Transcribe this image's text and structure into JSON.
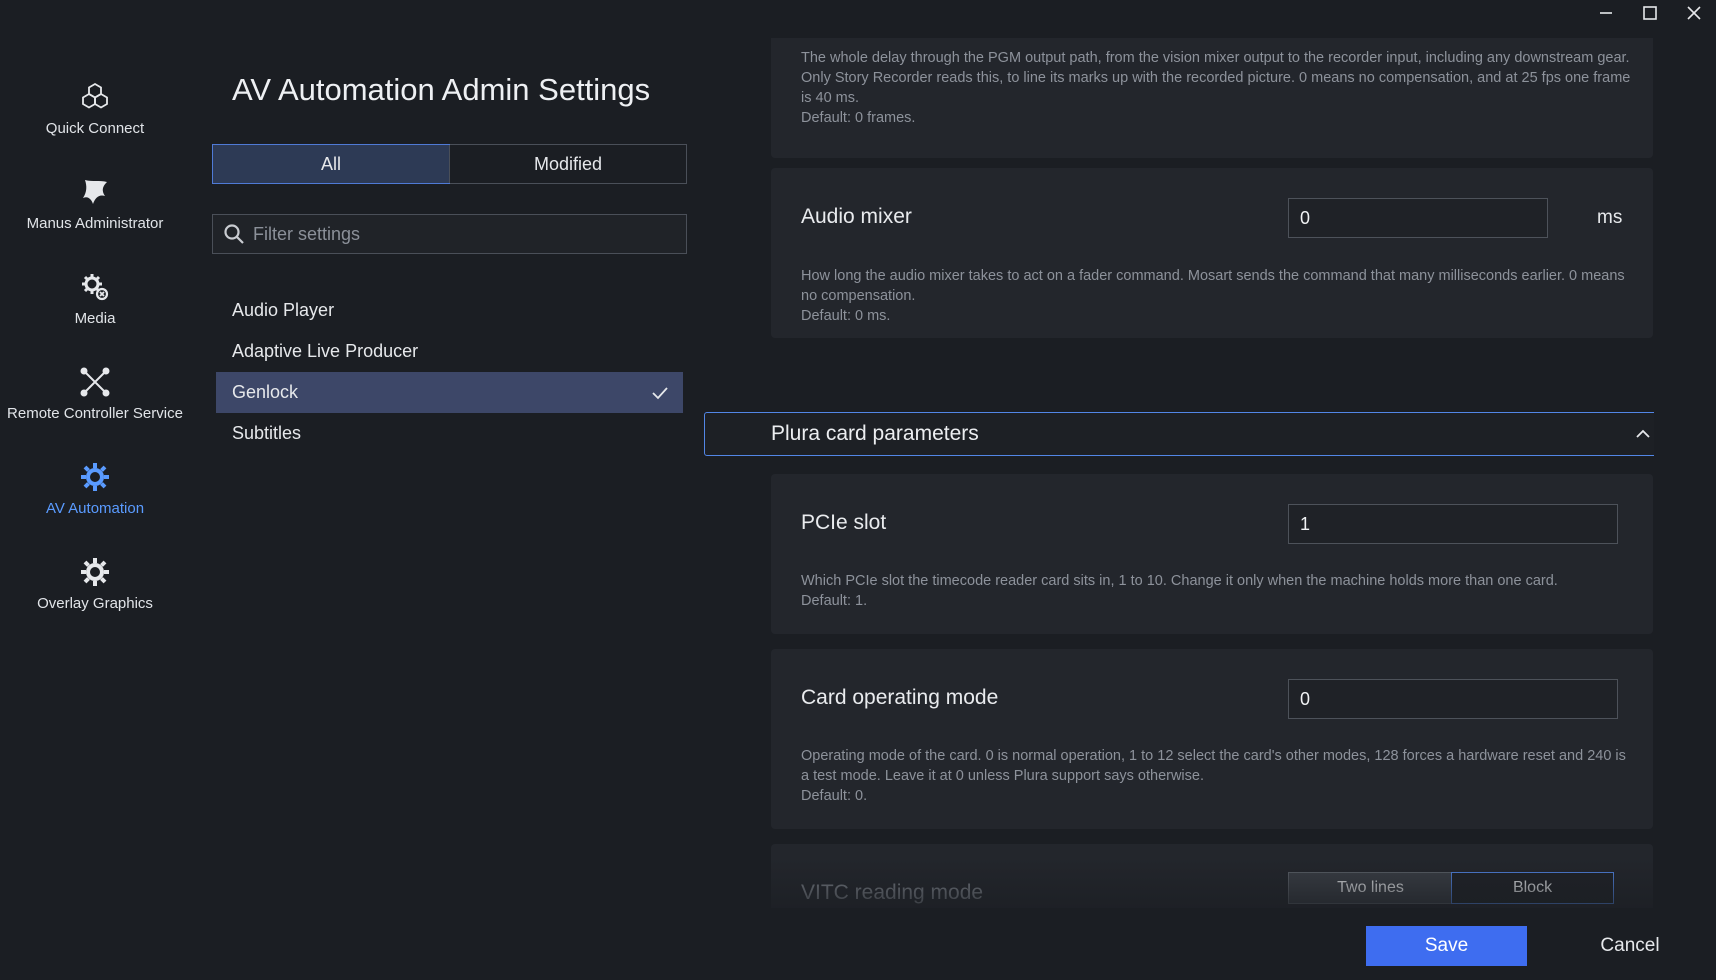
{
  "window": {
    "minimize_icon": "minimize-icon",
    "maximize_icon": "maximize-icon",
    "close_icon": "close-icon"
  },
  "nav": {
    "items": [
      {
        "label": "Quick Connect",
        "icon": "cubes-icon",
        "active": false
      },
      {
        "label": "Manus Administrator",
        "icon": "manus-logo-icon",
        "active": false
      },
      {
        "label": "Media",
        "icon": "media-gear-icon",
        "active": false
      },
      {
        "label": "Remote Controller Service",
        "icon": "remote-x-icon",
        "active": false
      },
      {
        "label": "AV Automation",
        "icon": "gear-icon",
        "active": true
      },
      {
        "label": "Overlay Graphics",
        "icon": "gear-icon",
        "active": false
      }
    ],
    "active_color": "#5a9bff"
  },
  "settings": {
    "title": "AV Automation Admin Settings",
    "tabs": [
      {
        "label": "All",
        "active": true
      },
      {
        "label": "Modified",
        "active": false
      }
    ],
    "search": {
      "placeholder": "Filter settings",
      "value": ""
    },
    "categories": [
      {
        "label": "Audio Player",
        "selected": false
      },
      {
        "label": "Adaptive Live Producer",
        "selected": false
      },
      {
        "label": "Genlock",
        "selected": true
      },
      {
        "label": "Subtitles",
        "selected": false
      }
    ]
  },
  "content": {
    "recorder_card": {
      "description": "The whole delay through the PGM output path, from the vision mixer output to the recorder input, including any downstream gear. Only Story Recorder reads this, to line its marks up with the recorded picture. 0 means no compensation, and at 25 fps one frame is 40 ms.",
      "default": "Default: 0 frames."
    },
    "audio_mixer": {
      "label": "Audio mixer",
      "value": "0",
      "unit": "ms",
      "description": "How long the audio mixer takes to act on a fader command. Mosart sends the command that many milliseconds earlier. 0 means no compensation.",
      "default": "Default: 0 ms."
    },
    "section": {
      "title": "Plura card parameters",
      "expanded": true
    },
    "pcie_slot": {
      "label": "PCIe slot",
      "value": "1",
      "description": "Which PCIe slot the timecode reader card sits in, 1 to 10. Change it only when the machine holds more than one card.",
      "default": "Default: 1."
    },
    "card_mode": {
      "label": "Card operating mode",
      "value": "0",
      "description": "Operating mode of the card. 0 is normal operation, 1 to 12 select the card's other modes, 128 forces a hardware reset and 240 is a test mode. Leave it at 0 unless Plura support says otherwise.",
      "default": "Default: 0."
    },
    "vitc": {
      "label": "VITC reading mode",
      "options": [
        {
          "label": "Two lines",
          "active": false
        },
        {
          "label": "Block",
          "active": true
        }
      ]
    }
  },
  "footer": {
    "save_label": "Save",
    "cancel_label": "Cancel",
    "save_color": "#3e6df0"
  }
}
